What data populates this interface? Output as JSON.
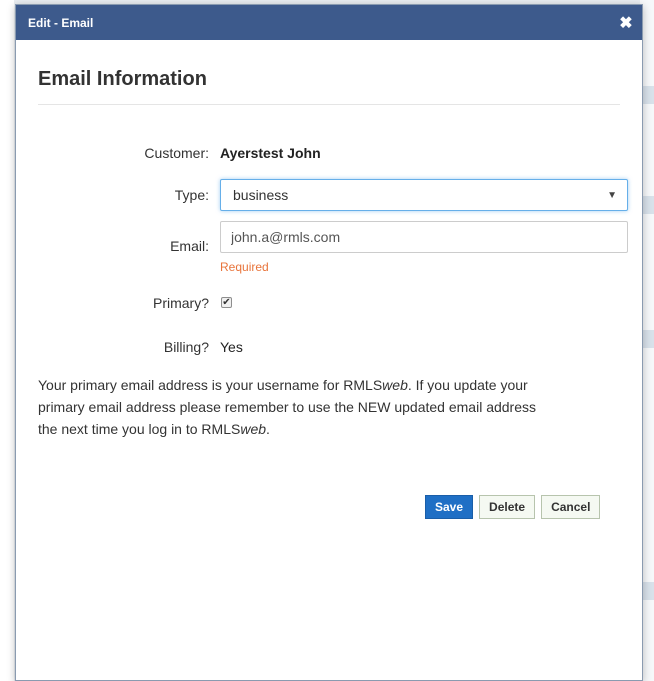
{
  "dialog": {
    "title": "Edit - Email",
    "close_glyph": "✖",
    "heading": "Email Information"
  },
  "form": {
    "customer_label": "Customer:",
    "customer_value": "Ayerstest John",
    "type_label": "Type:",
    "type_value": "business",
    "email_label": "Email:",
    "email_value": "john.a@rmls.com",
    "email_validation": "Required",
    "primary_label": "Primary?",
    "primary_checked": true,
    "billing_label": "Billing?",
    "billing_value": "Yes"
  },
  "note": {
    "part1": "Your primary email address is your username for RMLS",
    "brand_italic_1": "web",
    "part2": ". If you update your primary email address please remember to use the NEW updated email address the next time you log in to RMLS",
    "brand_italic_2": "web",
    "part3": "."
  },
  "buttons": {
    "save": "Save",
    "delete": "Delete",
    "cancel": "Cancel"
  },
  "colors": {
    "titlebar": "#3d5a8c",
    "primary_button": "#1f6fc5",
    "validation": "#e8743b"
  }
}
